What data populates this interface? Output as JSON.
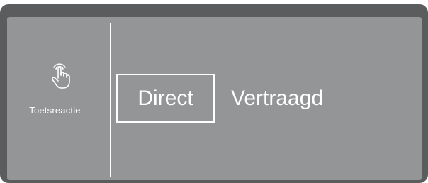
{
  "panel": {
    "sidebar": {
      "icon": "touch-hand-icon",
      "label": "Toetsreactie"
    },
    "options": [
      {
        "label": "Direct",
        "selected": true
      },
      {
        "label": "Vertraagd",
        "selected": false
      }
    ]
  },
  "colors": {
    "bezel": "#5b5c5e",
    "screen": "#949597",
    "foreground": "#ffffff"
  }
}
